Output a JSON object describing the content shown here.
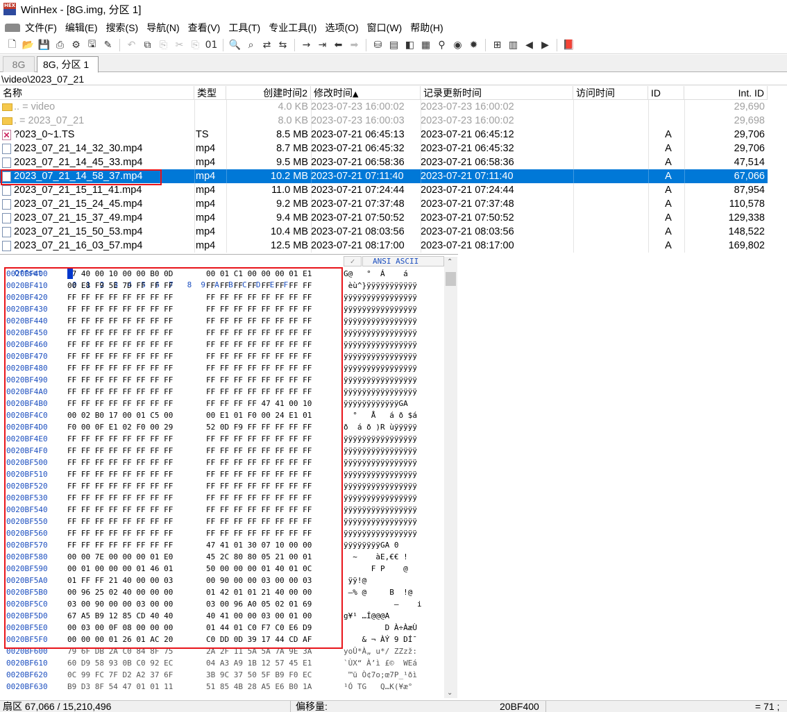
{
  "window": {
    "title": "WinHex - [8G.img, 分区 1]",
    "app_icon_text": "HEX"
  },
  "menu": [
    "文件(F)",
    "编辑(E)",
    "搜索(S)",
    "导航(N)",
    "查看(V)",
    "工具(T)",
    "专业工具(I)",
    "选项(O)",
    "窗口(W)",
    "帮助(H)"
  ],
  "toolbar_icons": [
    {
      "name": "new-file-icon",
      "glyph": "🗋"
    },
    {
      "name": "open-folder-icon",
      "glyph": "📂"
    },
    {
      "name": "save-icon",
      "glyph": "💾",
      "disabled": true
    },
    {
      "name": "print-icon",
      "glyph": "⎙"
    },
    {
      "name": "properties-icon",
      "glyph": "⚙"
    },
    {
      "name": "open-disk-icon",
      "glyph": "🖫"
    },
    {
      "name": "edit-data-icon",
      "glyph": "✎"
    },
    "sep",
    {
      "name": "undo-icon",
      "glyph": "↶",
      "disabled": true
    },
    {
      "name": "copy-icon",
      "glyph": "⧉"
    },
    {
      "name": "paste-icon",
      "glyph": "⎘",
      "disabled": true
    },
    {
      "name": "cut-icon",
      "glyph": "✂",
      "disabled": true
    },
    {
      "name": "paste-into-icon",
      "glyph": "⎘",
      "disabled": true
    },
    {
      "name": "binary-icon",
      "glyph": "01"
    },
    "sep",
    {
      "name": "find-text-icon",
      "glyph": "🔍"
    },
    {
      "name": "find-hex-icon",
      "glyph": "⌕"
    },
    {
      "name": "replace-text-icon",
      "glyph": "⇄"
    },
    {
      "name": "replace-hex-icon",
      "glyph": "⇆"
    },
    "sep",
    {
      "name": "goto-offset-icon",
      "glyph": "→"
    },
    {
      "name": "goto-sector-icon",
      "glyph": "⇥"
    },
    {
      "name": "back-icon",
      "glyph": "⬅"
    },
    {
      "name": "forward-icon",
      "glyph": "➡",
      "disabled": true
    },
    "sep",
    {
      "name": "disk-icon",
      "glyph": "⛁"
    },
    {
      "name": "ram-icon",
      "glyph": "▤"
    },
    {
      "name": "drive-icon",
      "glyph": "◧"
    },
    {
      "name": "calculator-icon",
      "glyph": "▦"
    },
    {
      "name": "magnifier-icon",
      "glyph": "⚲"
    },
    {
      "name": "camera-icon",
      "glyph": "◉"
    },
    {
      "name": "gear-icon",
      "glyph": "✹"
    },
    "sep",
    {
      "name": "tree-view-icon",
      "glyph": "⊞"
    },
    {
      "name": "table-view-icon",
      "glyph": "▥"
    },
    {
      "name": "prev-icon",
      "glyph": "◀"
    },
    {
      "name": "next-icon",
      "glyph": "▶"
    },
    "sep",
    {
      "name": "help-book-icon",
      "glyph": "📕"
    }
  ],
  "tabs": [
    "8G",
    "8G, 分区 1"
  ],
  "path": "\\video\\2023_07_21",
  "columns": {
    "name": "名称",
    "sort_arrow": "▲",
    "type": "类型",
    "created": "创建时间2",
    "modified": "修改时间",
    "record_updated": "记录更新时间",
    "accessed": "访问时间",
    "id": "ID",
    "int_id": "Int. ID"
  },
  "files": [
    {
      "name": "..  =  video",
      "type": "",
      "size": "4.0 KB",
      "modified": "2023-07-23  16:00:02",
      "record": "2023-07-23  16:00:02",
      "id": "",
      "int_id": "29,690",
      "kind": "folder",
      "gray": true
    },
    {
      "name": ".  =  2023_07_21",
      "type": "",
      "size": "8.0 KB",
      "modified": "2023-07-23  16:00:03",
      "record": "2023-07-23  16:00:02",
      "id": "",
      "int_id": "29,698",
      "kind": "folder",
      "gray": true
    },
    {
      "name": "?023_0~1.TS",
      "type": "TS",
      "size": "8.5 MB",
      "modified": "2023-07-21  06:45:13",
      "record": "2023-07-21  06:45:12",
      "id": "A",
      "int_id": "29,706",
      "kind": "ts"
    },
    {
      "name": "2023_07_21_14_32_30.mp4",
      "type": "mp4",
      "size": "8.7 MB",
      "modified": "2023-07-21  06:45:32",
      "record": "2023-07-21  06:45:32",
      "id": "A",
      "int_id": "29,706",
      "kind": "file"
    },
    {
      "name": "2023_07_21_14_45_33.mp4",
      "type": "mp4",
      "size": "9.5 MB",
      "modified": "2023-07-21  06:58:36",
      "record": "2023-07-21  06:58:36",
      "id": "A",
      "int_id": "47,514",
      "kind": "file"
    },
    {
      "name": "2023_07_21_14_58_37.mp4",
      "type": "mp4",
      "size": "10.2 MB",
      "modified": "2023-07-21  07:11:40",
      "record": "2023-07-21  07:11:40",
      "id": "A",
      "int_id": "67,066",
      "kind": "file",
      "selected": true
    },
    {
      "name": "2023_07_21_15_11_41.mp4",
      "type": "mp4",
      "size": "11.0 MB",
      "modified": "2023-07-21  07:24:44",
      "record": "2023-07-21  07:24:44",
      "id": "A",
      "int_id": "87,954",
      "kind": "file"
    },
    {
      "name": "2023_07_21_15_24_45.mp4",
      "type": "mp4",
      "size": "9.2 MB",
      "modified": "2023-07-21  07:37:48",
      "record": "2023-07-21  07:37:48",
      "id": "A",
      "int_id": "110,578",
      "kind": "file"
    },
    {
      "name": "2023_07_21_15_37_49.mp4",
      "type": "mp4",
      "size": "9.4 MB",
      "modified": "2023-07-21  07:50:52",
      "record": "2023-07-21  07:50:52",
      "id": "A",
      "int_id": "129,338",
      "kind": "file"
    },
    {
      "name": "2023_07_21_15_50_53.mp4",
      "type": "mp4",
      "size": "10.4 MB",
      "modified": "2023-07-21  08:03:56",
      "record": "2023-07-21  08:03:56",
      "id": "A",
      "int_id": "148,522",
      "kind": "file"
    },
    {
      "name": "2023_07_21_16_03_57.mp4",
      "type": "mp4",
      "size": "12.5 MB",
      "modified": "2023-07-21  08:17:00",
      "record": "2023-07-21  08:17:00",
      "id": "A",
      "int_id": "169,802",
      "kind": "file"
    }
  ],
  "hex_header": {
    "offset": "Offset",
    "cols": "0  1  2  3  4  5  6  7   8  9  A  B  C  D  E  F",
    "check": "✓",
    "ansi": "ANSI ASCII"
  },
  "hex_rows": [
    {
      "o": "0020BF400",
      "h1": "47 40 00 10 00 00 B0 0D",
      "h2": "00 01 C1 00 00 00 01 E1",
      "a": "G@   °  Á    á"
    },
    {
      "o": "0020BF410",
      "h1": "00 E8 F9 5E 7D FF FF FF",
      "h2": "FF FF FF FF FF FF FF FF",
      "a": " èù^}ÿÿÿÿÿÿÿÿÿÿÿ"
    },
    {
      "o": "0020BF420",
      "h1": "FF FF FF FF FF FF FF FF",
      "h2": "FF FF FF FF FF FF FF FF",
      "a": "ÿÿÿÿÿÿÿÿÿÿÿÿÿÿÿÿ"
    },
    {
      "o": "0020BF430",
      "h1": "FF FF FF FF FF FF FF FF",
      "h2": "FF FF FF FF FF FF FF FF",
      "a": "ÿÿÿÿÿÿÿÿÿÿÿÿÿÿÿÿ"
    },
    {
      "o": "0020BF440",
      "h1": "FF FF FF FF FF FF FF FF",
      "h2": "FF FF FF FF FF FF FF FF",
      "a": "ÿÿÿÿÿÿÿÿÿÿÿÿÿÿÿÿ"
    },
    {
      "o": "0020BF450",
      "h1": "FF FF FF FF FF FF FF FF",
      "h2": "FF FF FF FF FF FF FF FF",
      "a": "ÿÿÿÿÿÿÿÿÿÿÿÿÿÿÿÿ"
    },
    {
      "o": "0020BF460",
      "h1": "FF FF FF FF FF FF FF FF",
      "h2": "FF FF FF FF FF FF FF FF",
      "a": "ÿÿÿÿÿÿÿÿÿÿÿÿÿÿÿÿ"
    },
    {
      "o": "0020BF470",
      "h1": "FF FF FF FF FF FF FF FF",
      "h2": "FF FF FF FF FF FF FF FF",
      "a": "ÿÿÿÿÿÿÿÿÿÿÿÿÿÿÿÿ"
    },
    {
      "o": "0020BF480",
      "h1": "FF FF FF FF FF FF FF FF",
      "h2": "FF FF FF FF FF FF FF FF",
      "a": "ÿÿÿÿÿÿÿÿÿÿÿÿÿÿÿÿ"
    },
    {
      "o": "0020BF490",
      "h1": "FF FF FF FF FF FF FF FF",
      "h2": "FF FF FF FF FF FF FF FF",
      "a": "ÿÿÿÿÿÿÿÿÿÿÿÿÿÿÿÿ"
    },
    {
      "o": "0020BF4A0",
      "h1": "FF FF FF FF FF FF FF FF",
      "h2": "FF FF FF FF FF FF FF FF",
      "a": "ÿÿÿÿÿÿÿÿÿÿÿÿÿÿÿÿ"
    },
    {
      "o": "0020BF4B0",
      "h1": "FF FF FF FF FF FF FF FF",
      "h2": "FF FF FF FF 47 41 00 10",
      "a": "ÿÿÿÿÿÿÿÿÿÿÿÿGA"
    },
    {
      "o": "0020BF4C0",
      "h1": "00 02 B0 17 00 01 C5 00",
      "h2": "00 E1 01 F0 00 24 E1 01",
      "a": "  °   Å   á ð $á"
    },
    {
      "o": "0020BF4D0",
      "h1": "F0 00 0F E1 02 F0 00 29",
      "h2": "52 0D F9 FF FF FF FF FF",
      "a": "ð  á ð )R ùÿÿÿÿÿ"
    },
    {
      "o": "0020BF4E0",
      "h1": "FF FF FF FF FF FF FF FF",
      "h2": "FF FF FF FF FF FF FF FF",
      "a": "ÿÿÿÿÿÿÿÿÿÿÿÿÿÿÿÿ"
    },
    {
      "o": "0020BF4F0",
      "h1": "FF FF FF FF FF FF FF FF",
      "h2": "FF FF FF FF FF FF FF FF",
      "a": "ÿÿÿÿÿÿÿÿÿÿÿÿÿÿÿÿ"
    },
    {
      "o": "0020BF500",
      "h1": "FF FF FF FF FF FF FF FF",
      "h2": "FF FF FF FF FF FF FF FF",
      "a": "ÿÿÿÿÿÿÿÿÿÿÿÿÿÿÿÿ"
    },
    {
      "o": "0020BF510",
      "h1": "FF FF FF FF FF FF FF FF",
      "h2": "FF FF FF FF FF FF FF FF",
      "a": "ÿÿÿÿÿÿÿÿÿÿÿÿÿÿÿÿ"
    },
    {
      "o": "0020BF520",
      "h1": "FF FF FF FF FF FF FF FF",
      "h2": "FF FF FF FF FF FF FF FF",
      "a": "ÿÿÿÿÿÿÿÿÿÿÿÿÿÿÿÿ"
    },
    {
      "o": "0020BF530",
      "h1": "FF FF FF FF FF FF FF FF",
      "h2": "FF FF FF FF FF FF FF FF",
      "a": "ÿÿÿÿÿÿÿÿÿÿÿÿÿÿÿÿ"
    },
    {
      "o": "0020BF540",
      "h1": "FF FF FF FF FF FF FF FF",
      "h2": "FF FF FF FF FF FF FF FF",
      "a": "ÿÿÿÿÿÿÿÿÿÿÿÿÿÿÿÿ"
    },
    {
      "o": "0020BF550",
      "h1": "FF FF FF FF FF FF FF FF",
      "h2": "FF FF FF FF FF FF FF FF",
      "a": "ÿÿÿÿÿÿÿÿÿÿÿÿÿÿÿÿ"
    },
    {
      "o": "0020BF560",
      "h1": "FF FF FF FF FF FF FF FF",
      "h2": "FF FF FF FF FF FF FF FF",
      "a": "ÿÿÿÿÿÿÿÿÿÿÿÿÿÿÿÿ"
    },
    {
      "o": "0020BF570",
      "h1": "FF FF FF FF FF FF FF FF",
      "h2": "47 41 01 30 07 10 00 00",
      "a": "ÿÿÿÿÿÿÿÿGA 0"
    },
    {
      "o": "0020BF580",
      "h1": "00 00 7E 00 00 00 01 E0",
      "h2": "45 2C 80 80 05 21 00 01",
      "a": "  ~    àE,€€ !"
    },
    {
      "o": "0020BF590",
      "h1": "00 01 00 00 00 01 46 01",
      "h2": "50 00 00 00 01 40 01 0C",
      "a": "      F P    @"
    },
    {
      "o": "0020BF5A0",
      "h1": "01 FF FF 21 40 00 00 03",
      "h2": "00 90 00 00 03 00 00 03",
      "a": " ÿÿ!@"
    },
    {
      "o": "0020BF5B0",
      "h1": "00 96 25 02 40 00 00 00",
      "h2": "01 42 01 01 21 40 00 00",
      "a": " –% @     B  !@"
    },
    {
      "o": "0020BF5C0",
      "h1": "03 00 90 00 00 03 00 00",
      "h2": "03 00 96 A0 05 02 01 69",
      "a": "           –    i"
    },
    {
      "o": "0020BF5D0",
      "h1": "67 A5 B9 12 85 CD 40 40",
      "h2": "40 41 00 00 03 00 01 00",
      "a": "g¥¹ …Í@@@A"
    },
    {
      "o": "0020BF5E0",
      "h1": "00 03 00 0F 08 00 00 00",
      "h2": "01 44 01 C0 F7 C0 E6 D9",
      "a": "         D À÷ÀæÙ"
    },
    {
      "o": "0020BF5F0",
      "h1": "00 00 00 01 26 01 AC 20",
      "h2": "C0 DD 0D 39 17 44 CD AF",
      "a": "    & ¬ ÀÝ 9 DÍ¯"
    },
    {
      "o": "0020BF600",
      "h1": "79 6F DB 2A C0 84 8F 75",
      "h2": "2A 2F 11 5A 5A 7A 9E 3A",
      "a": "yoÛ*À„ u*/ ZZzž:",
      "dim": true
    },
    {
      "o": "0020BF610",
      "h1": "60 D9 58 93 0B C0 92 EC",
      "h2": "04 A3 A9 1B 12 57 45 E1",
      "a": "`ÙX“ À’ì £©  WEá",
      "dim": true
    },
    {
      "o": "0020BF620",
      "h1": "0C 99 FC 7F D2 A2 37 6F",
      "h2": "3B 9C 37 50 5F B9 F0 EC",
      "a": " ™ü Ò¢7o;œ7P_¹ðì",
      "dim": true
    },
    {
      "o": "0020BF630",
      "h1": "B9 D3 8F 54 47 01 01 11",
      "h2": "51 85 4B 28 A5 E6 B0 1A",
      "a": "¹Ó TG   Q…K(¥æ°",
      "dim": true
    }
  ],
  "status": {
    "sector": "扇区 67,066 / 15,210,496",
    "offset_label": "偏移量:",
    "offset_value": "20BF400",
    "value": "= 71 ;"
  },
  "colors": {
    "selection": "#0078d7",
    "highlight_box": "#e8141a",
    "offset_blue": "#1c4fbf"
  }
}
